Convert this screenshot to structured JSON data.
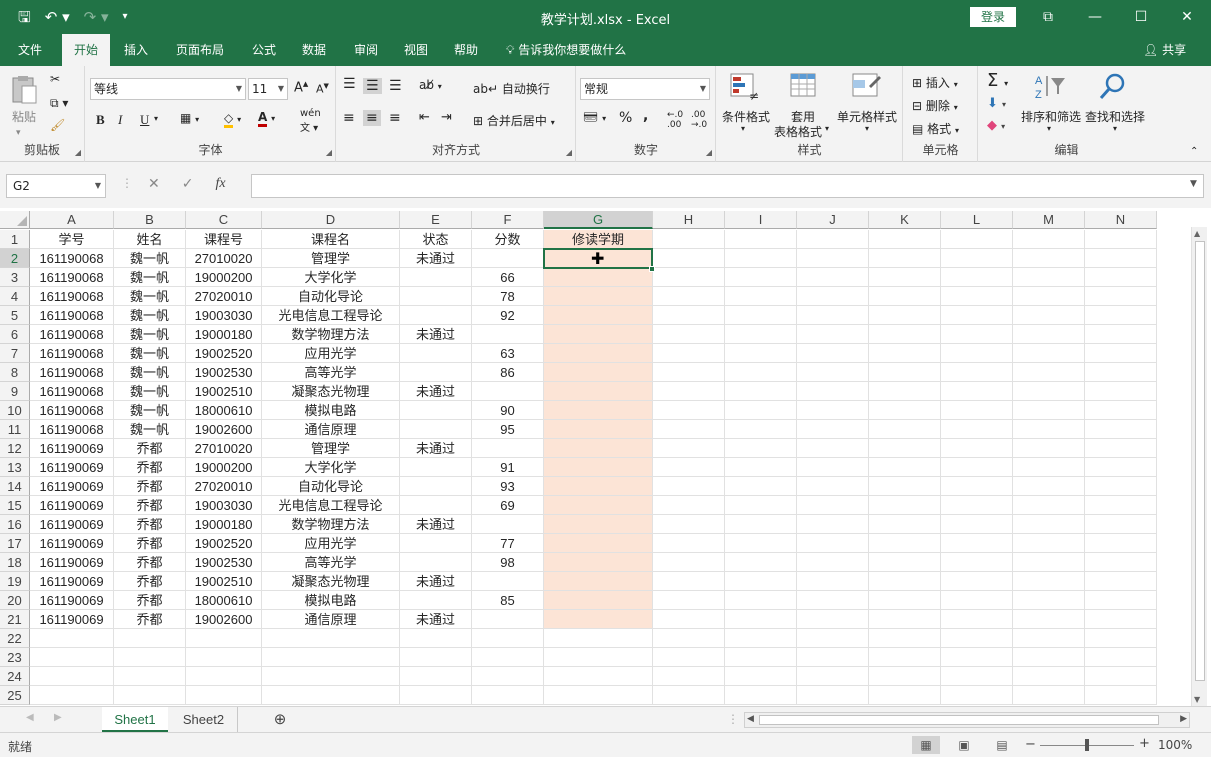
{
  "window": {
    "title": "教学计划.xlsx  -  Excel",
    "login": "登录",
    "controls": [
      "⧉",
      "—",
      "☐",
      "✕"
    ]
  },
  "menu": {
    "tabs": [
      "文件",
      "开始",
      "插入",
      "页面布局",
      "公式",
      "数据",
      "审阅",
      "视图",
      "帮助"
    ],
    "active": "开始",
    "tell_me": "告诉我你想要做什么",
    "share": "共享"
  },
  "ribbon": {
    "clipboard": {
      "paste": "粘贴",
      "label": "剪贴板"
    },
    "font": {
      "name": "等线",
      "size": "11",
      "bold": "B",
      "italic": "I",
      "underline": "U",
      "label": "字体"
    },
    "alignment": {
      "wrap": "自动换行",
      "merge": "合并后居中",
      "label": "对齐方式"
    },
    "number": {
      "format": "常规",
      "percent": "%",
      "comma": ",",
      "label": "数字"
    },
    "styles": {
      "conditional": "条件格式",
      "table1": "套用",
      "table2": "表格格式",
      "cell": "单元格样式",
      "label": "样式"
    },
    "cells": {
      "insert": "插入",
      "delete": "删除",
      "format": "格式",
      "label": "单元格"
    },
    "editing": {
      "sort": "排序和筛选",
      "find": "查找和选择",
      "label": "编辑"
    }
  },
  "formula_bar": {
    "name_box": "G2",
    "fx": "fx",
    "value": ""
  },
  "sheet": {
    "columns": [
      "A",
      "B",
      "C",
      "D",
      "E",
      "F",
      "G",
      "H",
      "I",
      "J",
      "K",
      "L",
      "M",
      "N"
    ],
    "selected_column": "G",
    "selected_row": 2,
    "row_numbers": [
      "1",
      "2",
      "3",
      "4",
      "5",
      "6",
      "7",
      "8",
      "9",
      "10",
      "11",
      "12",
      "13",
      "14",
      "15",
      "16",
      "17",
      "18",
      "19",
      "20",
      "21",
      "22",
      "23",
      "24",
      "25"
    ],
    "rows": [
      [
        "学号",
        "姓名",
        "课程号",
        "课程名",
        "状态",
        "分数",
        "修读学期"
      ],
      [
        "161190068",
        "魏一帆",
        "27010020",
        "管理学",
        "未通过",
        "",
        ""
      ],
      [
        "161190068",
        "魏一帆",
        "19000200",
        "大学化学",
        "",
        "66",
        ""
      ],
      [
        "161190068",
        "魏一帆",
        "27020010",
        "自动化导论",
        "",
        "78",
        ""
      ],
      [
        "161190068",
        "魏一帆",
        "19003030",
        "光电信息工程导论",
        "",
        "92",
        ""
      ],
      [
        "161190068",
        "魏一帆",
        "19000180",
        "数学物理方法",
        "未通过",
        "",
        ""
      ],
      [
        "161190068",
        "魏一帆",
        "19002520",
        "应用光学",
        "",
        "63",
        ""
      ],
      [
        "161190068",
        "魏一帆",
        "19002530",
        "高等光学",
        "",
        "86",
        ""
      ],
      [
        "161190068",
        "魏一帆",
        "19002510",
        "凝聚态光物理",
        "未通过",
        "",
        ""
      ],
      [
        "161190068",
        "魏一帆",
        "18000610",
        "模拟电路",
        "",
        "90",
        ""
      ],
      [
        "161190068",
        "魏一帆",
        "19002600",
        "通信原理",
        "",
        "95",
        ""
      ],
      [
        "161190069",
        "乔都",
        "27010020",
        "管理学",
        "未通过",
        "",
        ""
      ],
      [
        "161190069",
        "乔都",
        "19000200",
        "大学化学",
        "",
        "91",
        ""
      ],
      [
        "161190069",
        "乔都",
        "27020010",
        "自动化导论",
        "",
        "93",
        ""
      ],
      [
        "161190069",
        "乔都",
        "19003030",
        "光电信息工程导论",
        "",
        "69",
        ""
      ],
      [
        "161190069",
        "乔都",
        "19000180",
        "数学物理方法",
        "未通过",
        "",
        ""
      ],
      [
        "161190069",
        "乔都",
        "19002520",
        "应用光学",
        "",
        "77",
        ""
      ],
      [
        "161190069",
        "乔都",
        "19002530",
        "高等光学",
        "",
        "98",
        ""
      ],
      [
        "161190069",
        "乔都",
        "19002510",
        "凝聚态光物理",
        "未通过",
        "",
        ""
      ],
      [
        "161190069",
        "乔都",
        "18000610",
        "模拟电路",
        "",
        "85",
        ""
      ],
      [
        "161190069",
        "乔都",
        "19002600",
        "通信原理",
        "未通过",
        "",
        ""
      ]
    ],
    "highlight_color": "#fce4d6",
    "accent_color": "#217346"
  },
  "sheet_tabs": {
    "tabs": [
      "Sheet1",
      "Sheet2"
    ],
    "active": "Sheet1",
    "add": "⊕"
  },
  "status": {
    "text": "就绪",
    "zoom": "100%",
    "minus": "−",
    "plus": "+"
  }
}
